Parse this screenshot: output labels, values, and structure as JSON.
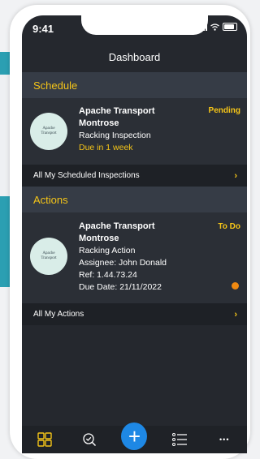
{
  "status_bar": {
    "time": "9:41"
  },
  "header": {
    "title": "Dashboard"
  },
  "schedule": {
    "section_title": "Schedule",
    "card": {
      "logo_line1": "Apache",
      "logo_line2": "Transport",
      "company": "Apache Transport",
      "location": "Montrose",
      "type": "Racking Inspection",
      "due": "Due in 1 week",
      "status": "Pending"
    },
    "link_label": "All My Scheduled Inspections"
  },
  "actions": {
    "section_title": "Actions",
    "card": {
      "logo_line1": "Apache",
      "logo_line2": "Transport",
      "company": "Apache Transport",
      "location": "Montrose",
      "type": "Racking Action",
      "assignee": "Assignee: John Donald",
      "ref": "Ref: 1.44.73.24",
      "due_date": "Due Date: 21/11/2022",
      "status": "To Do",
      "priority_color": "#f08a12"
    },
    "link_label": "All My Actions"
  },
  "tab_bar": {
    "tabs": [
      {
        "icon": "dashboard-grid-icon"
      },
      {
        "icon": "inspect-check-icon"
      },
      {
        "icon": "add-plus-icon",
        "label": "+"
      },
      {
        "icon": "list-icon"
      },
      {
        "icon": "more-dots-icon",
        "label": "•••"
      }
    ]
  },
  "colors": {
    "accent_yellow": "#f5c518",
    "fab_blue": "#1e88e5",
    "background_dark": "#25282e"
  }
}
